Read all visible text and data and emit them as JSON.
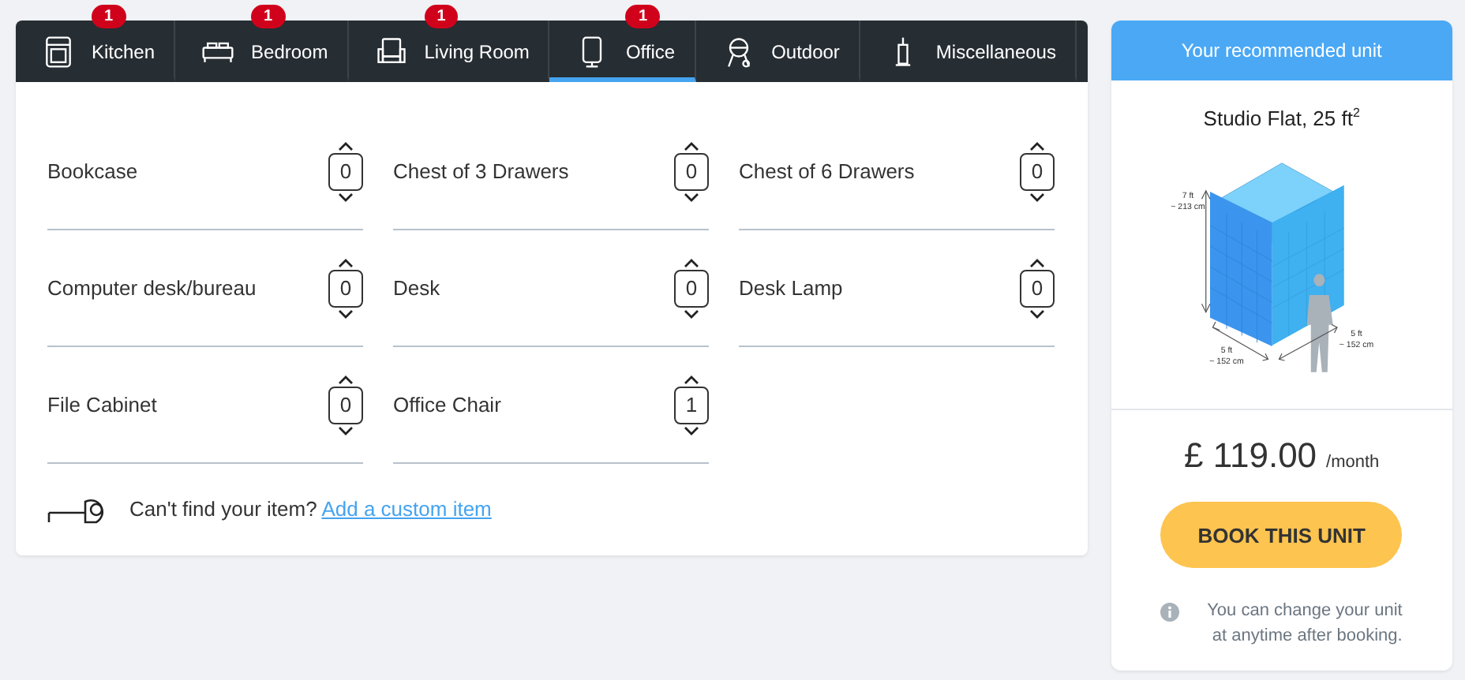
{
  "tabs": [
    {
      "label": "Kitchen",
      "badge": "1",
      "selected": false
    },
    {
      "label": "Bedroom",
      "badge": "1",
      "selected": false
    },
    {
      "label": "Living Room",
      "badge": "1",
      "selected": false
    },
    {
      "label": "Office",
      "badge": "1",
      "selected": true
    },
    {
      "label": "Outdoor",
      "selected": false
    },
    {
      "label": "Miscellaneous",
      "selected": false
    }
  ],
  "items": [
    {
      "name": "Bookcase",
      "count": "0"
    },
    {
      "name": "Chest of 3 Drawers",
      "count": "0"
    },
    {
      "name": "Chest of 6 Drawers",
      "count": "0"
    },
    {
      "name": "Computer desk/bureau",
      "count": "0"
    },
    {
      "name": "Desk",
      "count": "0"
    },
    {
      "name": "Desk Lamp",
      "count": "0"
    },
    {
      "name": "File Cabinet",
      "count": "0"
    },
    {
      "name": "Office Chair",
      "count": "1"
    }
  ],
  "custom": {
    "prompt": "Can't find your item?",
    "link": "Add a custom item"
  },
  "unit": {
    "header": "Your recommended unit",
    "title": "Studio Flat, 25 ft$^{2}$",
    "height_ft": "7 ft",
    "height_cm": "~ 213 cm",
    "width_ft": "5 ft",
    "width_cm": "~ 152 cm",
    "depth_ft": "5 ft",
    "depth_cm": "~ 152 cm",
    "price": "£ 119.00",
    "period": "/month",
    "button": "BOOK THIS UNIT",
    "note": "You can change your unit at anytime after booking."
  }
}
